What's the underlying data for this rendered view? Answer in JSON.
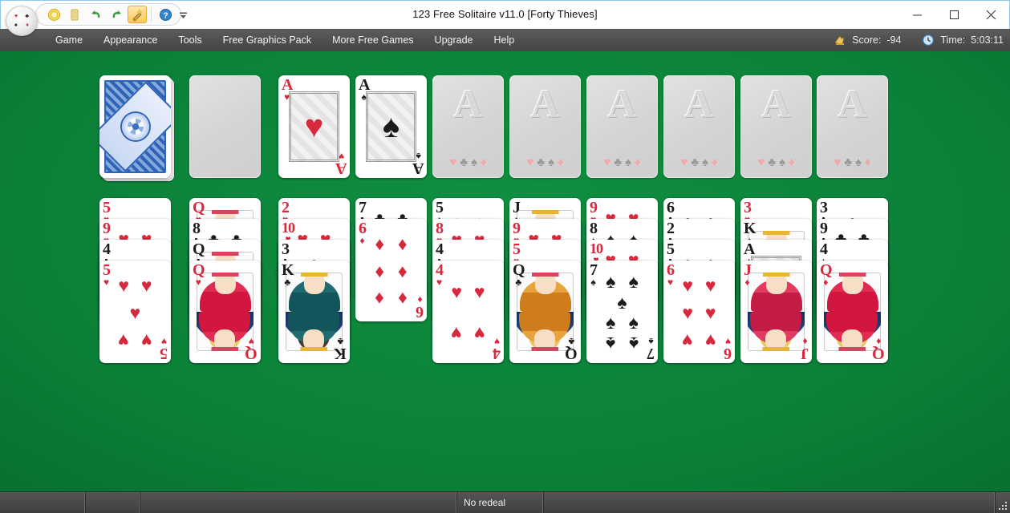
{
  "window": {
    "title": "123 Free Solitaire v11.0  [Forty Thieves]",
    "minimize_label": "Minimize",
    "maximize_label": "Maximize",
    "close_label": "Close"
  },
  "quick_access": {
    "buttons": [
      {
        "name": "new-game-icon",
        "tooltip": "New Game"
      },
      {
        "name": "deal-cards-icon",
        "tooltip": "Deal"
      },
      {
        "name": "undo-icon",
        "tooltip": "Undo"
      },
      {
        "name": "redo-icon",
        "tooltip": "Redo"
      },
      {
        "name": "hint-wand-icon",
        "tooltip": "Hint",
        "active": true
      },
      {
        "name": "help-icon",
        "tooltip": "Help"
      }
    ],
    "overflow_label": "More"
  },
  "menubar": {
    "items": [
      {
        "label": "Game"
      },
      {
        "label": "Appearance"
      },
      {
        "label": "Tools"
      },
      {
        "label": "Free Graphics Pack"
      },
      {
        "label": "More Free Games"
      },
      {
        "label": "Upgrade"
      },
      {
        "label": "Help"
      }
    ],
    "score_label": "Score:",
    "score_value": "-94",
    "time_label": "Time:",
    "time_value": "5:03:11"
  },
  "board": {
    "stock": {
      "type": "back",
      "label": "Stock"
    },
    "waste": {
      "type": "empty-slot",
      "label": "Waste"
    },
    "foundations": [
      {
        "rank": "A",
        "suit": "hearts",
        "color": "red"
      },
      {
        "rank": "A",
        "suit": "spades",
        "color": "black"
      },
      {
        "placeholder": "A"
      },
      {
        "placeholder": "A"
      },
      {
        "placeholder": "A"
      },
      {
        "placeholder": "A"
      },
      {
        "placeholder": "A"
      },
      {
        "placeholder": "A"
      }
    ],
    "foundation_placeholder_suits": [
      "♥",
      "♣",
      "♠",
      "♦"
    ],
    "tableau": [
      {
        "cards": [
          {
            "rank": "5",
            "suit": "hearts",
            "color": "red"
          },
          {
            "rank": "9",
            "suit": "hearts",
            "color": "red"
          },
          {
            "rank": "4",
            "suit": "clubs",
            "color": "black"
          },
          {
            "rank": "5",
            "suit": "hearts",
            "color": "red"
          }
        ]
      },
      {
        "cards": [
          {
            "rank": "Q",
            "suit": "hearts",
            "color": "red"
          },
          {
            "rank": "8",
            "suit": "clubs",
            "color": "black"
          },
          {
            "rank": "Q",
            "suit": "clubs",
            "color": "black"
          },
          {
            "rank": "Q",
            "suit": "hearts",
            "color": "red"
          }
        ]
      },
      {
        "cards": [
          {
            "rank": "2",
            "suit": "hearts",
            "color": "red"
          },
          {
            "rank": "10",
            "suit": "hearts",
            "color": "red"
          },
          {
            "rank": "3",
            "suit": "clubs",
            "color": "black"
          },
          {
            "rank": "K",
            "suit": "clubs",
            "color": "black"
          }
        ]
      },
      {
        "cards": [
          {
            "rank": "7",
            "suit": "clubs",
            "color": "black"
          },
          {
            "rank": "6",
            "suit": "diamonds",
            "color": "red"
          }
        ]
      },
      {
        "cards": [
          {
            "rank": "5",
            "suit": "spades",
            "color": "black"
          },
          {
            "rank": "8",
            "suit": "hearts",
            "color": "red"
          },
          {
            "rank": "4",
            "suit": "clubs",
            "color": "black"
          },
          {
            "rank": "4",
            "suit": "hearts",
            "color": "red"
          }
        ]
      },
      {
        "cards": [
          {
            "rank": "J",
            "suit": "spades",
            "color": "black"
          },
          {
            "rank": "9",
            "suit": "hearts",
            "color": "red"
          },
          {
            "rank": "5",
            "suit": "hearts",
            "color": "red"
          },
          {
            "rank": "Q",
            "suit": "clubs",
            "color": "black"
          }
        ]
      },
      {
        "cards": [
          {
            "rank": "9",
            "suit": "hearts",
            "color": "red"
          },
          {
            "rank": "8",
            "suit": "spades",
            "color": "black"
          },
          {
            "rank": "10",
            "suit": "hearts",
            "color": "red"
          },
          {
            "rank": "7",
            "suit": "spades",
            "color": "black"
          }
        ]
      },
      {
        "cards": [
          {
            "rank": "6",
            "suit": "clubs",
            "color": "black"
          },
          {
            "rank": "2",
            "suit": "clubs",
            "color": "black"
          },
          {
            "rank": "5",
            "suit": "clubs",
            "color": "black"
          },
          {
            "rank": "6",
            "suit": "hearts",
            "color": "red"
          }
        ]
      },
      {
        "cards": [
          {
            "rank": "3",
            "suit": "hearts",
            "color": "red"
          },
          {
            "rank": "K",
            "suit": "spades",
            "color": "black"
          },
          {
            "rank": "A",
            "suit": "spades",
            "color": "black"
          },
          {
            "rank": "J",
            "suit": "diamonds",
            "color": "red"
          }
        ]
      },
      {
        "cards": [
          {
            "rank": "3",
            "suit": "clubs",
            "color": "black"
          },
          {
            "rank": "9",
            "suit": "clubs",
            "color": "black"
          },
          {
            "rank": "4",
            "suit": "spades",
            "color": "black"
          },
          {
            "rank": "Q",
            "suit": "diamonds",
            "color": "red"
          }
        ]
      }
    ]
  },
  "statusbar": {
    "cells": [
      "",
      "",
      "",
      ""
    ],
    "redeal_text": "No redeal"
  },
  "colors": {
    "felt": "#0b8038",
    "red_suit": "#d6293e",
    "black_suit": "#1b1b1b",
    "menubar": "#4e4e4e",
    "card_back_blue": "#3b6fc0"
  }
}
